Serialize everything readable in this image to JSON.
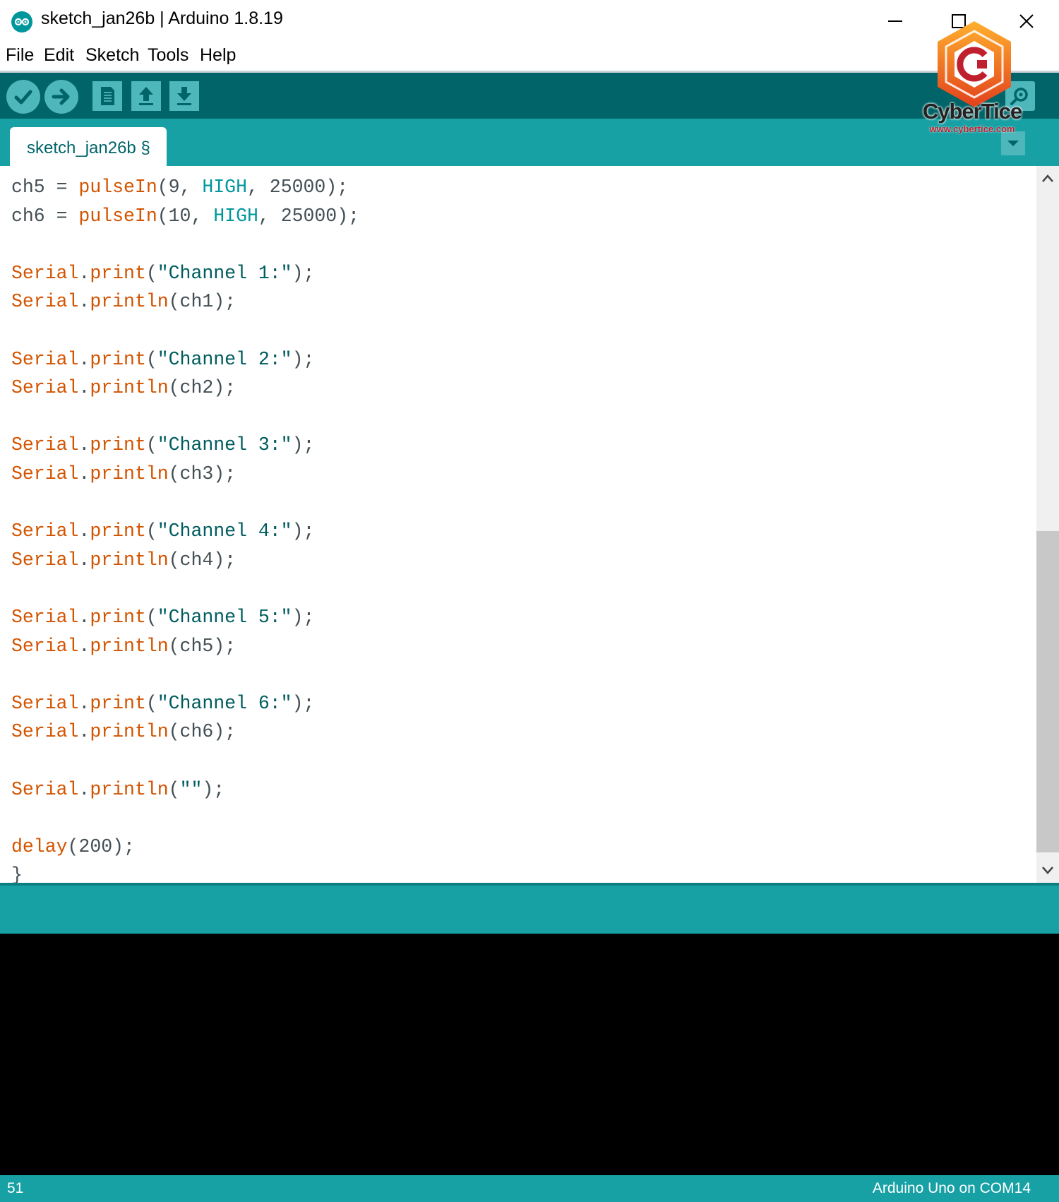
{
  "window": {
    "title": "sketch_jan26b | Arduino 1.8.19",
    "controls": [
      "minimize",
      "maximize",
      "close"
    ]
  },
  "menu": [
    "File",
    "Edit",
    "Sketch",
    "Tools",
    "Help"
  ],
  "toolbar": {
    "buttons": [
      "verify-icon",
      "upload-icon",
      "new-icon",
      "open-icon",
      "save-icon"
    ],
    "serial_monitor": "serial-monitor-icon"
  },
  "tabs": [
    {
      "label": "sketch_jan26b §",
      "active": true
    }
  ],
  "editor": {
    "lines": [
      [
        {
          "t": "ch5 = ",
          "c": "plain"
        },
        {
          "t": "pulseIn",
          "c": "func"
        },
        {
          "t": "(9, ",
          "c": "plain"
        },
        {
          "t": "HIGH",
          "c": "const"
        },
        {
          "t": ", 25000);",
          "c": "plain"
        }
      ],
      [
        {
          "t": "ch6 = ",
          "c": "plain"
        },
        {
          "t": "pulseIn",
          "c": "func"
        },
        {
          "t": "(10, ",
          "c": "plain"
        },
        {
          "t": "HIGH",
          "c": "const"
        },
        {
          "t": ", 25000);",
          "c": "plain"
        }
      ],
      [],
      [
        {
          "t": "Serial",
          "c": "func"
        },
        {
          "t": ".",
          "c": "plain"
        },
        {
          "t": "print",
          "c": "func"
        },
        {
          "t": "(",
          "c": "plain"
        },
        {
          "t": "\"Channel 1:\"",
          "c": "str"
        },
        {
          "t": ");",
          "c": "plain"
        }
      ],
      [
        {
          "t": "Serial",
          "c": "func"
        },
        {
          "t": ".",
          "c": "plain"
        },
        {
          "t": "println",
          "c": "func"
        },
        {
          "t": "(ch1);",
          "c": "plain"
        }
      ],
      [],
      [
        {
          "t": "Serial",
          "c": "func"
        },
        {
          "t": ".",
          "c": "plain"
        },
        {
          "t": "print",
          "c": "func"
        },
        {
          "t": "(",
          "c": "plain"
        },
        {
          "t": "\"Channel 2:\"",
          "c": "str"
        },
        {
          "t": ");",
          "c": "plain"
        }
      ],
      [
        {
          "t": "Serial",
          "c": "func"
        },
        {
          "t": ".",
          "c": "plain"
        },
        {
          "t": "println",
          "c": "func"
        },
        {
          "t": "(ch2);",
          "c": "plain"
        }
      ],
      [],
      [
        {
          "t": "Serial",
          "c": "func"
        },
        {
          "t": ".",
          "c": "plain"
        },
        {
          "t": "print",
          "c": "func"
        },
        {
          "t": "(",
          "c": "plain"
        },
        {
          "t": "\"Channel 3:\"",
          "c": "str"
        },
        {
          "t": ");",
          "c": "plain"
        }
      ],
      [
        {
          "t": "Serial",
          "c": "func"
        },
        {
          "t": ".",
          "c": "plain"
        },
        {
          "t": "println",
          "c": "func"
        },
        {
          "t": "(ch3);",
          "c": "plain"
        }
      ],
      [],
      [
        {
          "t": "Serial",
          "c": "func"
        },
        {
          "t": ".",
          "c": "plain"
        },
        {
          "t": "print",
          "c": "func"
        },
        {
          "t": "(",
          "c": "plain"
        },
        {
          "t": "\"Channel 4:\"",
          "c": "str"
        },
        {
          "t": ");",
          "c": "plain"
        }
      ],
      [
        {
          "t": "Serial",
          "c": "func"
        },
        {
          "t": ".",
          "c": "plain"
        },
        {
          "t": "println",
          "c": "func"
        },
        {
          "t": "(ch4);",
          "c": "plain"
        }
      ],
      [],
      [
        {
          "t": "Serial",
          "c": "func"
        },
        {
          "t": ".",
          "c": "plain"
        },
        {
          "t": "print",
          "c": "func"
        },
        {
          "t": "(",
          "c": "plain"
        },
        {
          "t": "\"Channel 5:\"",
          "c": "str"
        },
        {
          "t": ");",
          "c": "plain"
        }
      ],
      [
        {
          "t": "Serial",
          "c": "func"
        },
        {
          "t": ".",
          "c": "plain"
        },
        {
          "t": "println",
          "c": "func"
        },
        {
          "t": "(ch5);",
          "c": "plain"
        }
      ],
      [],
      [
        {
          "t": "Serial",
          "c": "func"
        },
        {
          "t": ".",
          "c": "plain"
        },
        {
          "t": "print",
          "c": "func"
        },
        {
          "t": "(",
          "c": "plain"
        },
        {
          "t": "\"Channel 6:\"",
          "c": "str"
        },
        {
          "t": ");",
          "c": "plain"
        }
      ],
      [
        {
          "t": "Serial",
          "c": "func"
        },
        {
          "t": ".",
          "c": "plain"
        },
        {
          "t": "println",
          "c": "func"
        },
        {
          "t": "(ch6);",
          "c": "plain"
        }
      ],
      [],
      [
        {
          "t": "Serial",
          "c": "func"
        },
        {
          "t": ".",
          "c": "plain"
        },
        {
          "t": "println",
          "c": "func"
        },
        {
          "t": "(",
          "c": "plain"
        },
        {
          "t": "\"\"",
          "c": "str"
        },
        {
          "t": ");",
          "c": "plain"
        }
      ],
      [],
      [
        {
          "t": "delay",
          "c": "func"
        },
        {
          "t": "(200);",
          "c": "plain"
        }
      ],
      [
        {
          "t": "}",
          "c": "plain"
        }
      ]
    ]
  },
  "status": {
    "line_number": "51",
    "board": "Arduino Uno on COM14"
  },
  "watermark": {
    "brand": "CyberTice",
    "url": "www.cybertice.com"
  },
  "colors": {
    "toolbar": "#006468",
    "accent": "#17a1a5",
    "button": "#4db7bb",
    "keyword_orange": "#d35400",
    "constant_teal": "#00979c",
    "string": "#005c5f",
    "console": "#000000"
  }
}
